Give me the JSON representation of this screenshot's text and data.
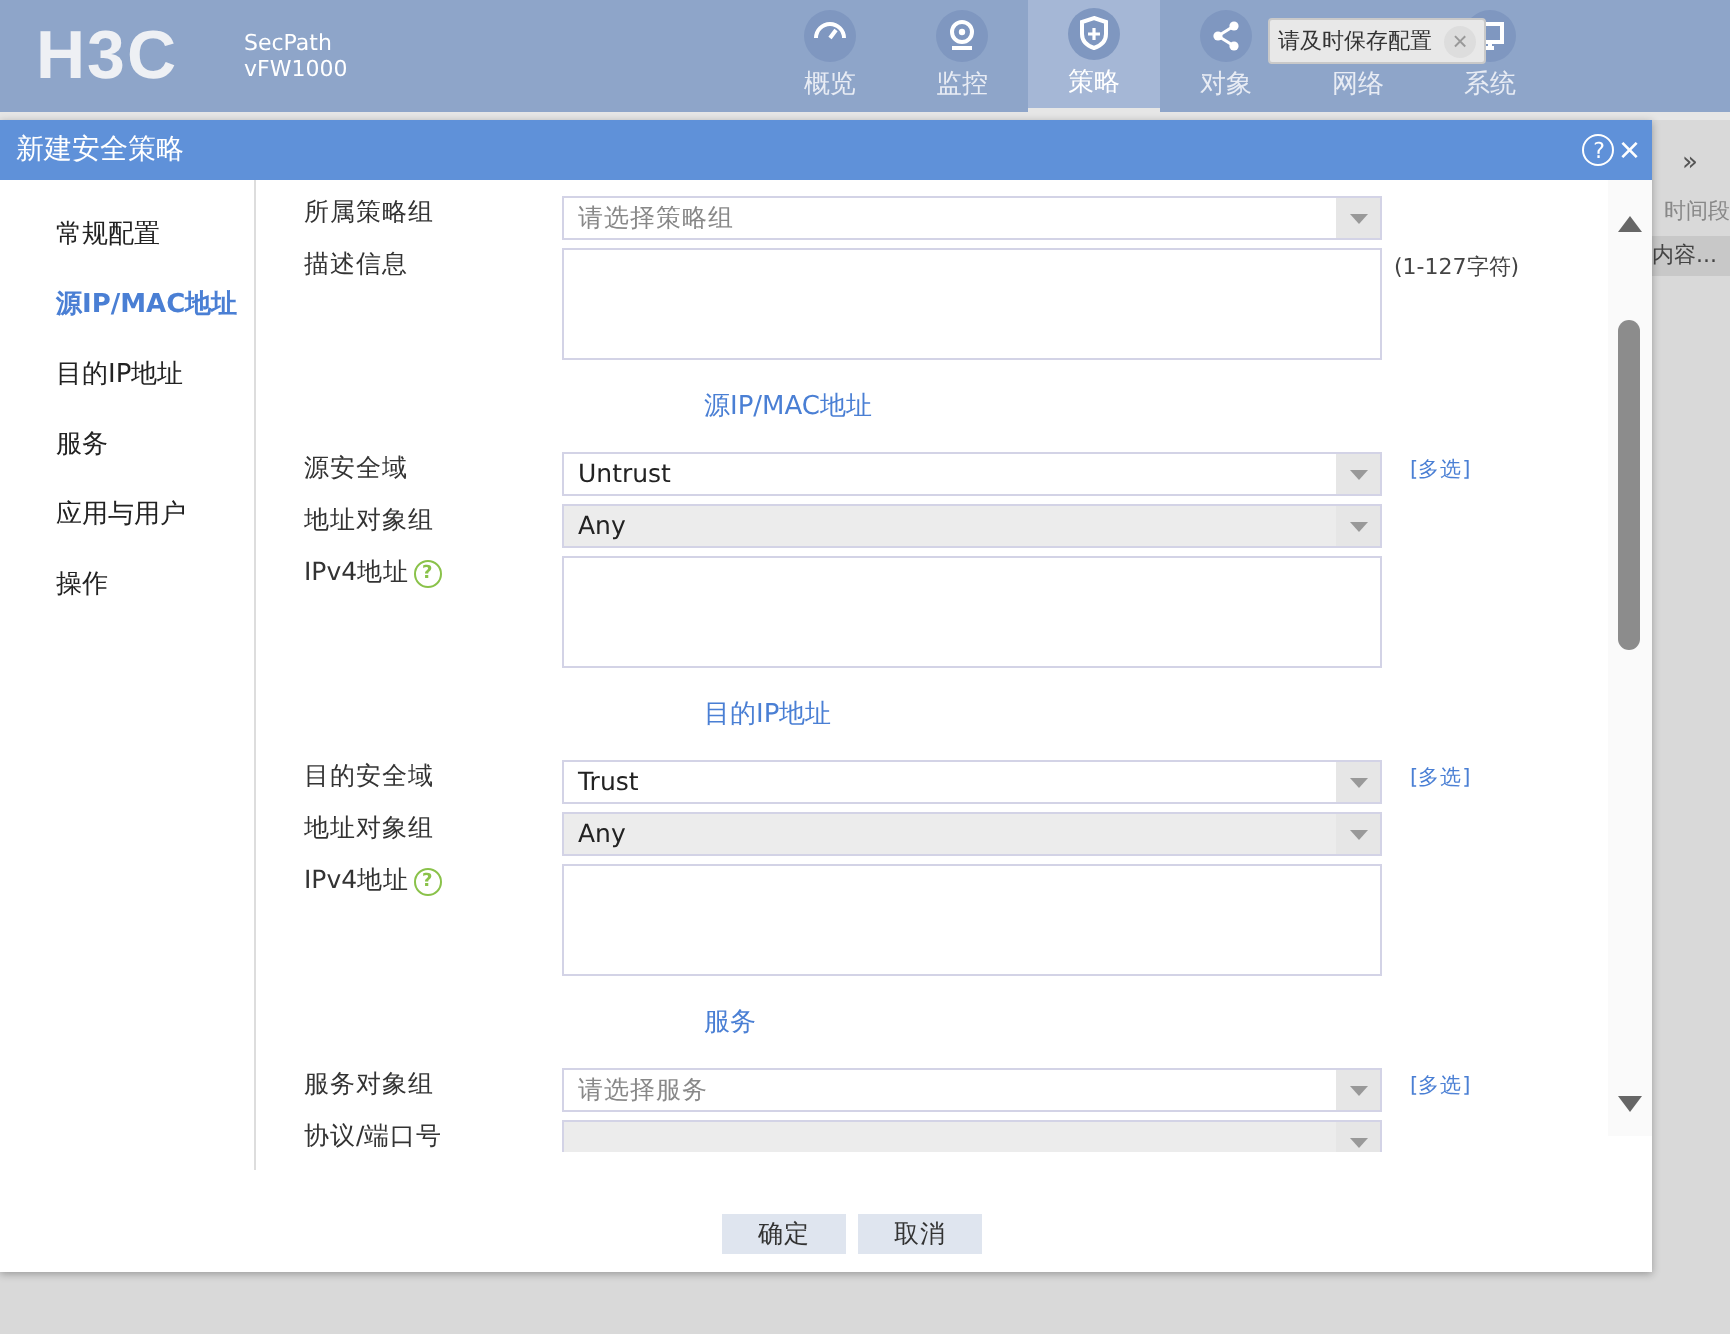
{
  "header": {
    "logo": "H3C",
    "product": "SecPath",
    "model": "vFW1000",
    "nav": [
      {
        "label": "概览",
        "selected": false
      },
      {
        "label": "监控",
        "selected": false
      },
      {
        "label": "策略",
        "selected": true
      },
      {
        "label": "对象",
        "selected": false
      },
      {
        "label": "网络",
        "selected": false
      },
      {
        "label": "系统",
        "selected": false
      }
    ],
    "toast": {
      "text": "请及时保存配置",
      "close": "×"
    }
  },
  "background": {
    "expand": "»",
    "column": "时间段",
    "cell": "内容..."
  },
  "dialog": {
    "title": "新建安全策略",
    "help": "?",
    "close": "×",
    "sidebar": [
      {
        "label": "常规配置",
        "selected": false
      },
      {
        "label": "源IP/MAC地址",
        "selected": true
      },
      {
        "label": "目的IP地址",
        "selected": false
      },
      {
        "label": "服务",
        "selected": false
      },
      {
        "label": "应用与用户",
        "selected": false
      },
      {
        "label": "操作",
        "selected": false
      }
    ],
    "form": [
      {
        "kind": "select",
        "label": "所属策略组",
        "placeholder": "请选择策略组",
        "disabled": false
      },
      {
        "kind": "textarea",
        "label": "描述信息",
        "hint": "(1-127字符)"
      },
      {
        "kind": "section",
        "title": "源IP/MAC地址"
      },
      {
        "kind": "select",
        "label": "源安全域",
        "value": "Untrust",
        "disabled": false,
        "link": "[多选]"
      },
      {
        "kind": "select",
        "label": "地址对象组",
        "value": "Any",
        "disabled": true
      },
      {
        "kind": "textarea",
        "label": "IPv4地址",
        "help": "?"
      },
      {
        "kind": "section",
        "title": "目的IP地址"
      },
      {
        "kind": "select",
        "label": "目的安全域",
        "value": "Trust",
        "disabled": false,
        "link": "[多选]"
      },
      {
        "kind": "select",
        "label": "地址对象组",
        "value": "Any",
        "disabled": true
      },
      {
        "kind": "textarea",
        "label": "IPv4地址",
        "help": "?"
      },
      {
        "kind": "section",
        "title": "服务"
      },
      {
        "kind": "select",
        "label": "服务对象组",
        "placeholder": "请选择服务",
        "disabled": false,
        "link": "[多选]"
      },
      {
        "kind": "select",
        "label": "协议/端口号",
        "disabled": true
      }
    ],
    "buttons": [
      "确定",
      "取消"
    ]
  }
}
